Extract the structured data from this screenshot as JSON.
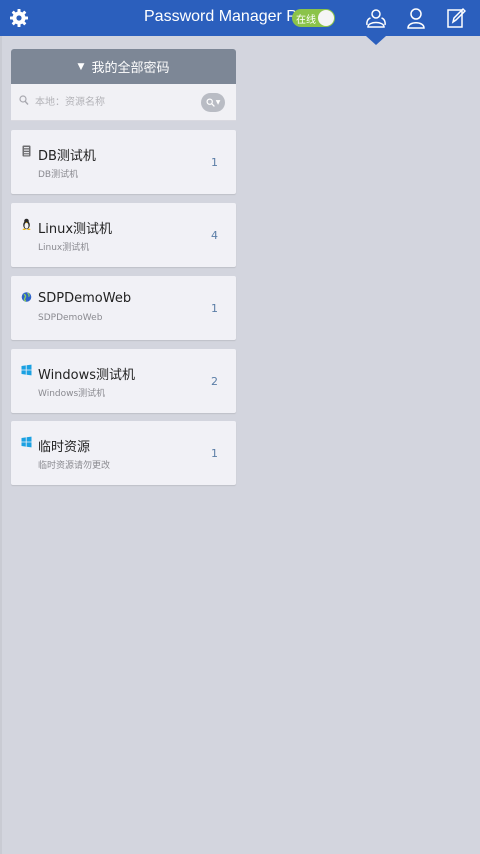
{
  "header": {
    "title": "Password Manager Pro",
    "status_toggle": {
      "label": "在线",
      "on": true,
      "color": "#8bc34a"
    },
    "bar_color": "#2b5fbd",
    "icons": [
      "gear-icon",
      "resources-icon",
      "user-icon",
      "edit-icon"
    ],
    "active_tab": "resources-icon"
  },
  "panel": {
    "header": {
      "label": "我的全部密码",
      "icon": "caret-down-icon"
    },
    "search": {
      "placeholder": "本地：资源名称",
      "value": ""
    },
    "items": [
      {
        "name": "DB测试机",
        "desc": "DB测试机",
        "count": "1",
        "icon": "database-icon"
      },
      {
        "name": "Linux测试机",
        "desc": "Linux测试机",
        "count": "4",
        "icon": "linux-icon"
      },
      {
        "name": "SDPDemoWeb",
        "desc": "SDPDemoWeb",
        "count": "1",
        "icon": "web-icon"
      },
      {
        "name": "Windows测试机",
        "desc": "Windows测试机",
        "count": "2",
        "icon": "windows-icon"
      },
      {
        "name": "临时资源",
        "desc": "临时资源请勿更改",
        "count": "1",
        "icon": "windows-icon"
      }
    ]
  }
}
